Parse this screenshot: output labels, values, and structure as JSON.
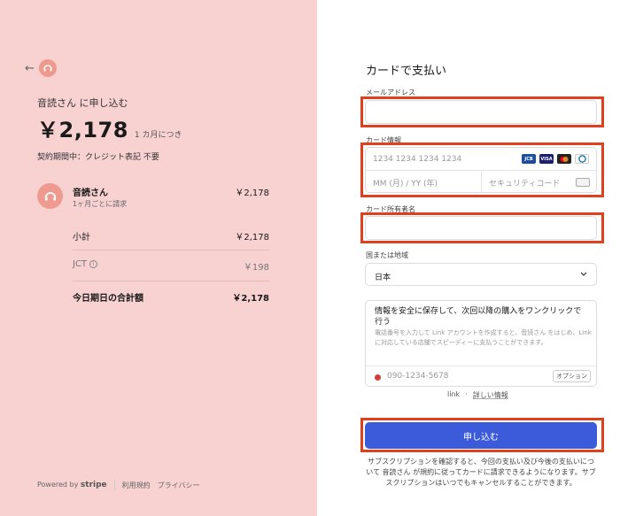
{
  "left": {
    "back_arrow": "←",
    "product_title": "音読さん に申し込む",
    "price": "￥2,178",
    "price_period": "1 カ月につき",
    "contract_note": "契約期間中：クレジット表記 不要",
    "item": {
      "name": "音読さん",
      "sub": "1ヶ月ごとに請求",
      "price": "￥2,178"
    },
    "subtotal_label": "小計",
    "subtotal_value": "￥2,178",
    "tax_label": "JCT",
    "tax_info": "i",
    "tax_value": "￥198",
    "total_label": "今日期日の合計額",
    "total_value": "￥2,178",
    "footer": {
      "powered_by": "Powered by",
      "stripe": "stripe",
      "terms": "利用規約",
      "privacy": "プライバシー"
    }
  },
  "right": {
    "title": "カードで支払い",
    "email_label": "メールアドレス",
    "card_label": "カード情報",
    "card_number_placeholder": "1234 1234 1234 1234",
    "expiry_placeholder": "MM (月) / YY (年)",
    "cvc_placeholder": "セキュリティコード",
    "cardholder_label": "カード所有者名",
    "country_label": "国または地域",
    "country_value": "日本",
    "link_headline": "情報を安全に保存して、次回以降の購入をワンクリックで行う",
    "link_desc": "電話番号を入力して Link アカウントを作成すると、音読さん をはじめ、Link に対応している店舗でスピーディーに支払うことができます。",
    "phone_placeholder": "090-1234-5678",
    "option_badge": "オプション",
    "link_brand": "link",
    "link_sep": "·",
    "link_details": "詳しい情報",
    "submit_label": "申し込む",
    "disclaimer": "サブスクリプションを確認すると、今回の支払い及び今後の支払いについて 音読さん が規約に従ってカードに請求できるようになります。サブスクリプションはいつでもキャンセルすることができます。"
  },
  "brand_colors": {
    "left_bg": "#f8d1d1",
    "accent": "#3b5bdb",
    "highlight": "#e0401e",
    "logo": "#ef9a8f"
  },
  "card_brands": [
    "JCB",
    "VISA",
    "MC",
    "DC"
  ]
}
